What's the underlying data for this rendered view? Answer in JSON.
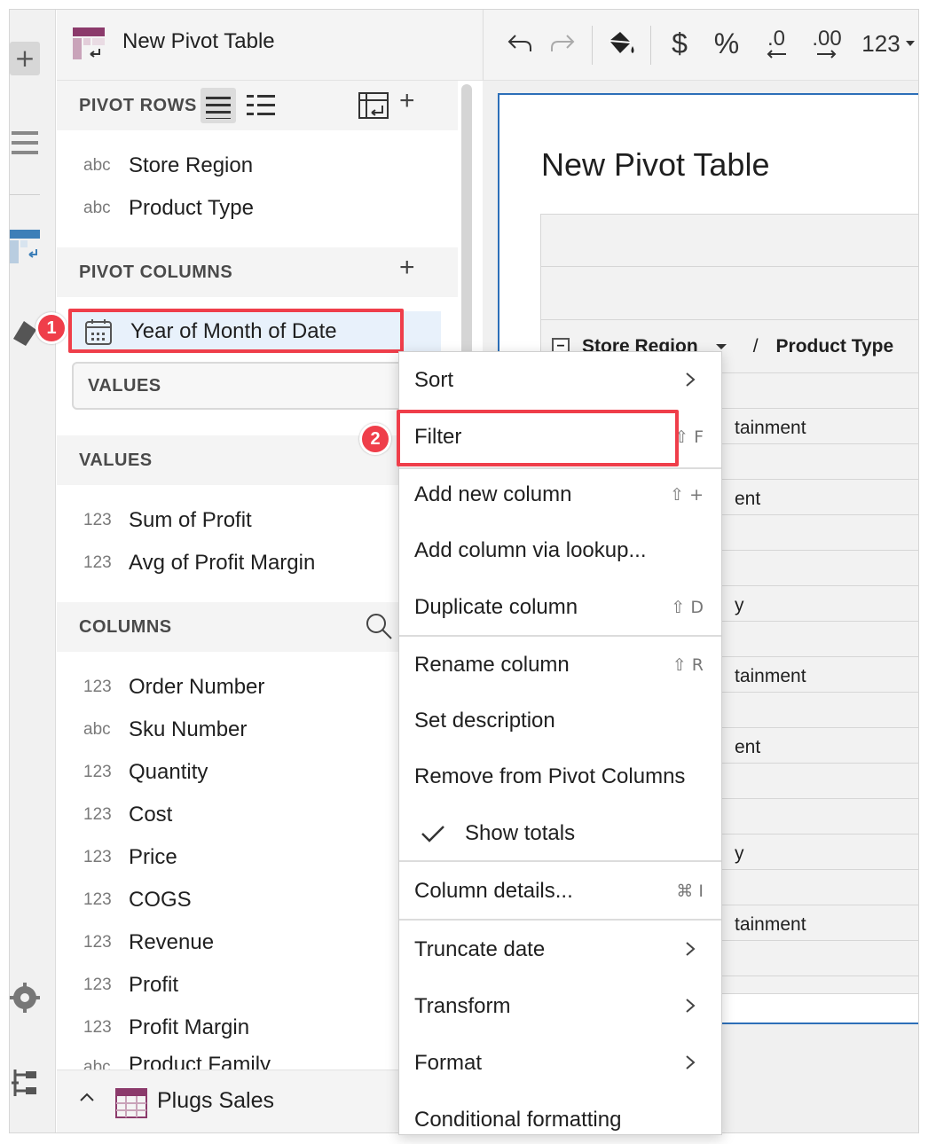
{
  "panel": {
    "title": "New Pivot Table",
    "pivot_rows_label": "PIVOT ROWS",
    "pivot_rows": [
      {
        "type": "abc",
        "name": "Store Region"
      },
      {
        "type": "abc",
        "name": "Product Type"
      }
    ],
    "pivot_columns_label": "PIVOT COLUMNS",
    "pivot_column": "Year of Month of Date",
    "values_drop_label": "VALUES",
    "values_label": "VALUES",
    "values": [
      {
        "type": "123",
        "name": "Sum of Profit"
      },
      {
        "type": "123",
        "name": "Avg of Profit Margin"
      }
    ],
    "columns_label": "COLUMNS",
    "columns": [
      {
        "type": "123",
        "name": "Order Number"
      },
      {
        "type": "abc",
        "name": "Sku Number"
      },
      {
        "type": "123",
        "name": "Quantity"
      },
      {
        "type": "123",
        "name": "Cost"
      },
      {
        "type": "123",
        "name": "Price"
      },
      {
        "type": "123",
        "name": "COGS"
      },
      {
        "type": "123",
        "name": "Revenue"
      },
      {
        "type": "123",
        "name": "Profit"
      },
      {
        "type": "123",
        "name": "Profit Margin"
      },
      {
        "type": "abc",
        "name": "Product Family"
      }
    ],
    "source": "Plugs Sales"
  },
  "toolbar": {
    "currency": "$",
    "percent": "%",
    "dec_decrease": ".0",
    "dec_increase": ".00",
    "number_format": "123"
  },
  "sheet": {
    "title": "New Pivot Table",
    "header_row": "Store Region",
    "header_sep": "/",
    "header_col2": "Product Type",
    "cells": [
      "tainment",
      "ent",
      "y",
      "tainment",
      "ent",
      "y",
      "tainment"
    ]
  },
  "annotations": {
    "step1": "1",
    "step2": "2"
  },
  "menu": {
    "items": [
      {
        "label": "Sort",
        "shortcut": "",
        "submenu": true
      },
      {
        "label": "Filter",
        "shortcut": "⇧ F",
        "submenu": false
      },
      {
        "label": "Add new column",
        "shortcut": "⇧ +",
        "submenu": false
      },
      {
        "label": "Add column via lookup...",
        "shortcut": "",
        "submenu": false
      },
      {
        "label": "Duplicate column",
        "shortcut": "⇧ D",
        "submenu": false
      },
      {
        "label": "Rename column",
        "shortcut": "⇧ R",
        "submenu": false
      },
      {
        "label": "Set description",
        "shortcut": "",
        "submenu": false
      },
      {
        "label": "Remove from Pivot Columns",
        "shortcut": "",
        "submenu": false
      },
      {
        "label": "Show totals",
        "shortcut": "",
        "submenu": false,
        "checked": true
      },
      {
        "label": "Column details...",
        "shortcut": "⌘ I",
        "submenu": false
      },
      {
        "label": "Truncate date",
        "shortcut": "",
        "submenu": true
      },
      {
        "label": "Transform",
        "shortcut": "",
        "submenu": true
      },
      {
        "label": "Format",
        "shortcut": "",
        "submenu": true
      },
      {
        "label": "Conditional formatting",
        "shortcut": "",
        "submenu": false
      }
    ]
  },
  "colors": {
    "highlight": "#ef3e4a",
    "accent_blue": "#2d6fb8",
    "selected_bg": "#e8f1fb"
  }
}
